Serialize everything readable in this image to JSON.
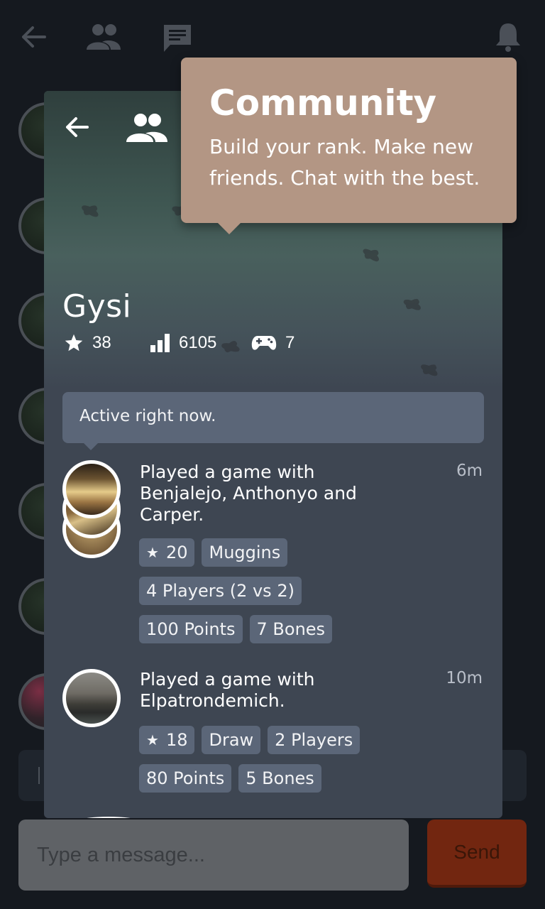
{
  "colors": {
    "background": "#15191f",
    "card": "#3e4652",
    "chip": "#5b6678",
    "tooltip": "#b39684",
    "send_button": "#722610"
  },
  "background": {
    "icons": [
      "back-arrow-icon",
      "people-icon",
      "chat-icon",
      "bell-icon"
    ]
  },
  "composer": {
    "placeholder": "Type a message...",
    "send_label": "Send"
  },
  "tooltip": {
    "title": "Community",
    "body": "Build your rank. Make new friends. Chat with the best."
  },
  "profile": {
    "name": "Gysi",
    "stats": {
      "stars": "38",
      "rank": "6105",
      "games": "7"
    },
    "status": "Active right now."
  },
  "feed": [
    {
      "text": "Played a game with Benjalejo, Anthonyo and Carper.",
      "time": "6m",
      "chips": {
        "stars": "20",
        "mode": "Muggins",
        "players": "4 Players (2 vs 2)",
        "points": "100 Points",
        "bones": "7 Bones"
      }
    },
    {
      "text": "Played a game with Elpatrondemich.",
      "time": "10m",
      "chips": {
        "stars": "18",
        "mode": "Draw",
        "players": "2 Players",
        "points": "80 Points",
        "bones": "5 Bones"
      }
    }
  ]
}
